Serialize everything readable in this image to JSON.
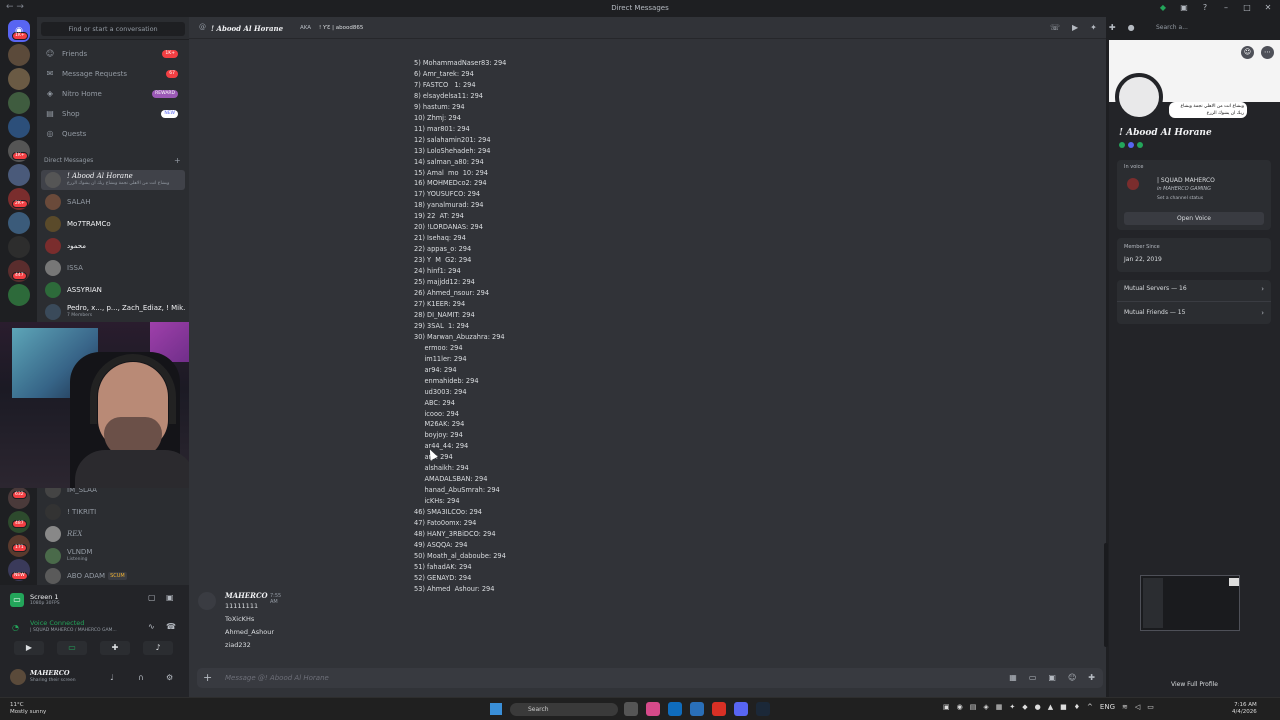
{
  "window": {
    "title": "Direct Messages"
  },
  "guild_badges": [
    "1K+",
    "",
    "",
    "",
    "",
    "1K+",
    "",
    "2K+",
    "447",
    "",
    "",
    "",
    "632",
    "",
    "487",
    "",
    "171",
    "NEW"
  ],
  "sidebar": {
    "find_placeholder": "Find or start a conversation",
    "nav": [
      {
        "label": "Friends",
        "badge": "1K+"
      },
      {
        "label": "Message Requests",
        "badge": "67"
      },
      {
        "label": "Nitro Home",
        "badge": "REWARD"
      },
      {
        "label": "Shop",
        "badge": "NEW"
      },
      {
        "label": "Quests",
        "badge": ""
      }
    ],
    "section_label": "Direct Messages",
    "dms": [
      {
        "name": "! Abood Al Horane",
        "sub": "وبشاع انت من الاهلي نجمة وبشاع ربك ان يشوك الزرع"
      },
      {
        "name": "SALAH",
        "sub": ""
      },
      {
        "name": "Mo7TRAMCo",
        "sub": ""
      },
      {
        "name": "محمود",
        "sub": ""
      },
      {
        "name": "ISSA",
        "sub": ""
      },
      {
        "name": "ASSYRIAN",
        "sub": ""
      },
      {
        "name": "Pedro, x..., p..., Zach_Ediaz, ! Mik...",
        "sub": "7 Members"
      },
      {
        "name": "IM_SLAA",
        "sub": ""
      },
      {
        "name": "! TIKRITI",
        "sub": ""
      },
      {
        "name": "REX",
        "sub": ""
      },
      {
        "name": "VLNDM",
        "sub": "Listening"
      },
      {
        "name": "ABO ADAM",
        "sub": "",
        "tag": "SCUM"
      }
    ]
  },
  "voice_panel": {
    "screen_title": "Screen 1",
    "screen_sub": "1080p 30FPS",
    "status": "Voice Connected",
    "channel": "| SQUAD MAHERCO / MAHERCO GAM...",
    "user_name": "MAHERCO",
    "user_status": "Sharing their screen"
  },
  "chat_header": {
    "name": "! Abood Al Horane",
    "aka": "AKA",
    "aka_values": "! ƳƐ | abood865"
  },
  "search_placeholder": "Search a...",
  "list_lines": [
    "5) MohammadNaser83: 294",
    "6) Amr_tarek: 294",
    "7) FASTCO   1: 294",
    "8) elsaydelsa11: 294",
    "9) hastum: 294",
    "10) Zhmj: 294",
    "11) mar801: 294",
    "12) salahamin201: 294",
    "13) LoloShehadeh: 294",
    "14) salman_a80: 294",
    "15) Amal  mo  10: 294",
    "16) MOHMEDco2: 294",
    "17) YOUSUFCO: 294",
    "18) yanalmurad: 294",
    "19) 22  AT: 294",
    "20) !LORDANAS: 294",
    "21) Isehaq: 294",
    "22) appas_o: 294",
    "23) Y  M  G2: 294",
    "24) hinf1: 294",
    "25) majjdd12: 294",
    "26) Ahmed_nsour: 294",
    "27) K1EER: 294",
    "28) DI_NAMIT: 294",
    "29) 3SAL  1: 294",
    "30) Marwan_Abuzahra: 294",
    "     ermoo: 294",
    "     im11ler: 294",
    "     ar94: 294",
    "     enmahideb: 294",
    "     ud3003: 294",
    "     ABC: 294",
    "     icooo: 294",
    "     M26AK: 294",
    "     boyjoy: 294",
    "     ar44_44: 294",
    "     arJr: 294",
    "     alshaikh: 294",
    "     AMADALSBAN: 294",
    "     hanad_AbuSmrah: 294",
    "     icKHs: 294",
    "46) SMA3ILCOo: 294",
    "47) Fato0omx: 294",
    "48) HANY_3RBiDCO: 294",
    "49) ASQQA: 294",
    "50) Moath_al_daboube: 294",
    "51) fahadAK: 294",
    "52) GENAYD: 294",
    "53) Ahmed  Ashour: 294"
  ],
  "message": {
    "author": "MAHERCO",
    "time": "7:55 AM",
    "lines": [
      "11111111",
      "ToXicKHs",
      "Ahmed_Ashour",
      "ziad232"
    ]
  },
  "composer": {
    "placeholder": "Message @! Abood Al Horane"
  },
  "profile": {
    "name": "! Abood Al Horane",
    "status_text": "وبشاع انت من الاهلي نجمة وبشاع ربك ان يشوك الزرع",
    "in_voice_label": "In voice",
    "voice_server": "| SQUAD MAHERCO",
    "voice_in": "in MAHERCO GAMING",
    "voice_status": "Set a channel status",
    "open_voice": "Open Voice",
    "member_since_label": "Member Since",
    "member_since": "Jan 22, 2019",
    "mutual_servers": "Mutual Servers — 16",
    "mutual_friends": "Mutual Friends — 15",
    "view_full": "View Full Profile"
  },
  "taskbar": {
    "temp": "11°C",
    "weather": "Mostly sunny",
    "search": "Search",
    "lang": "ENG",
    "time": "7:16 AM",
    "date": "4/4/2026"
  },
  "colors": {
    "accent": "#5865f2",
    "danger": "#f23f43",
    "online": "#23a55a",
    "bg": "#313338"
  }
}
